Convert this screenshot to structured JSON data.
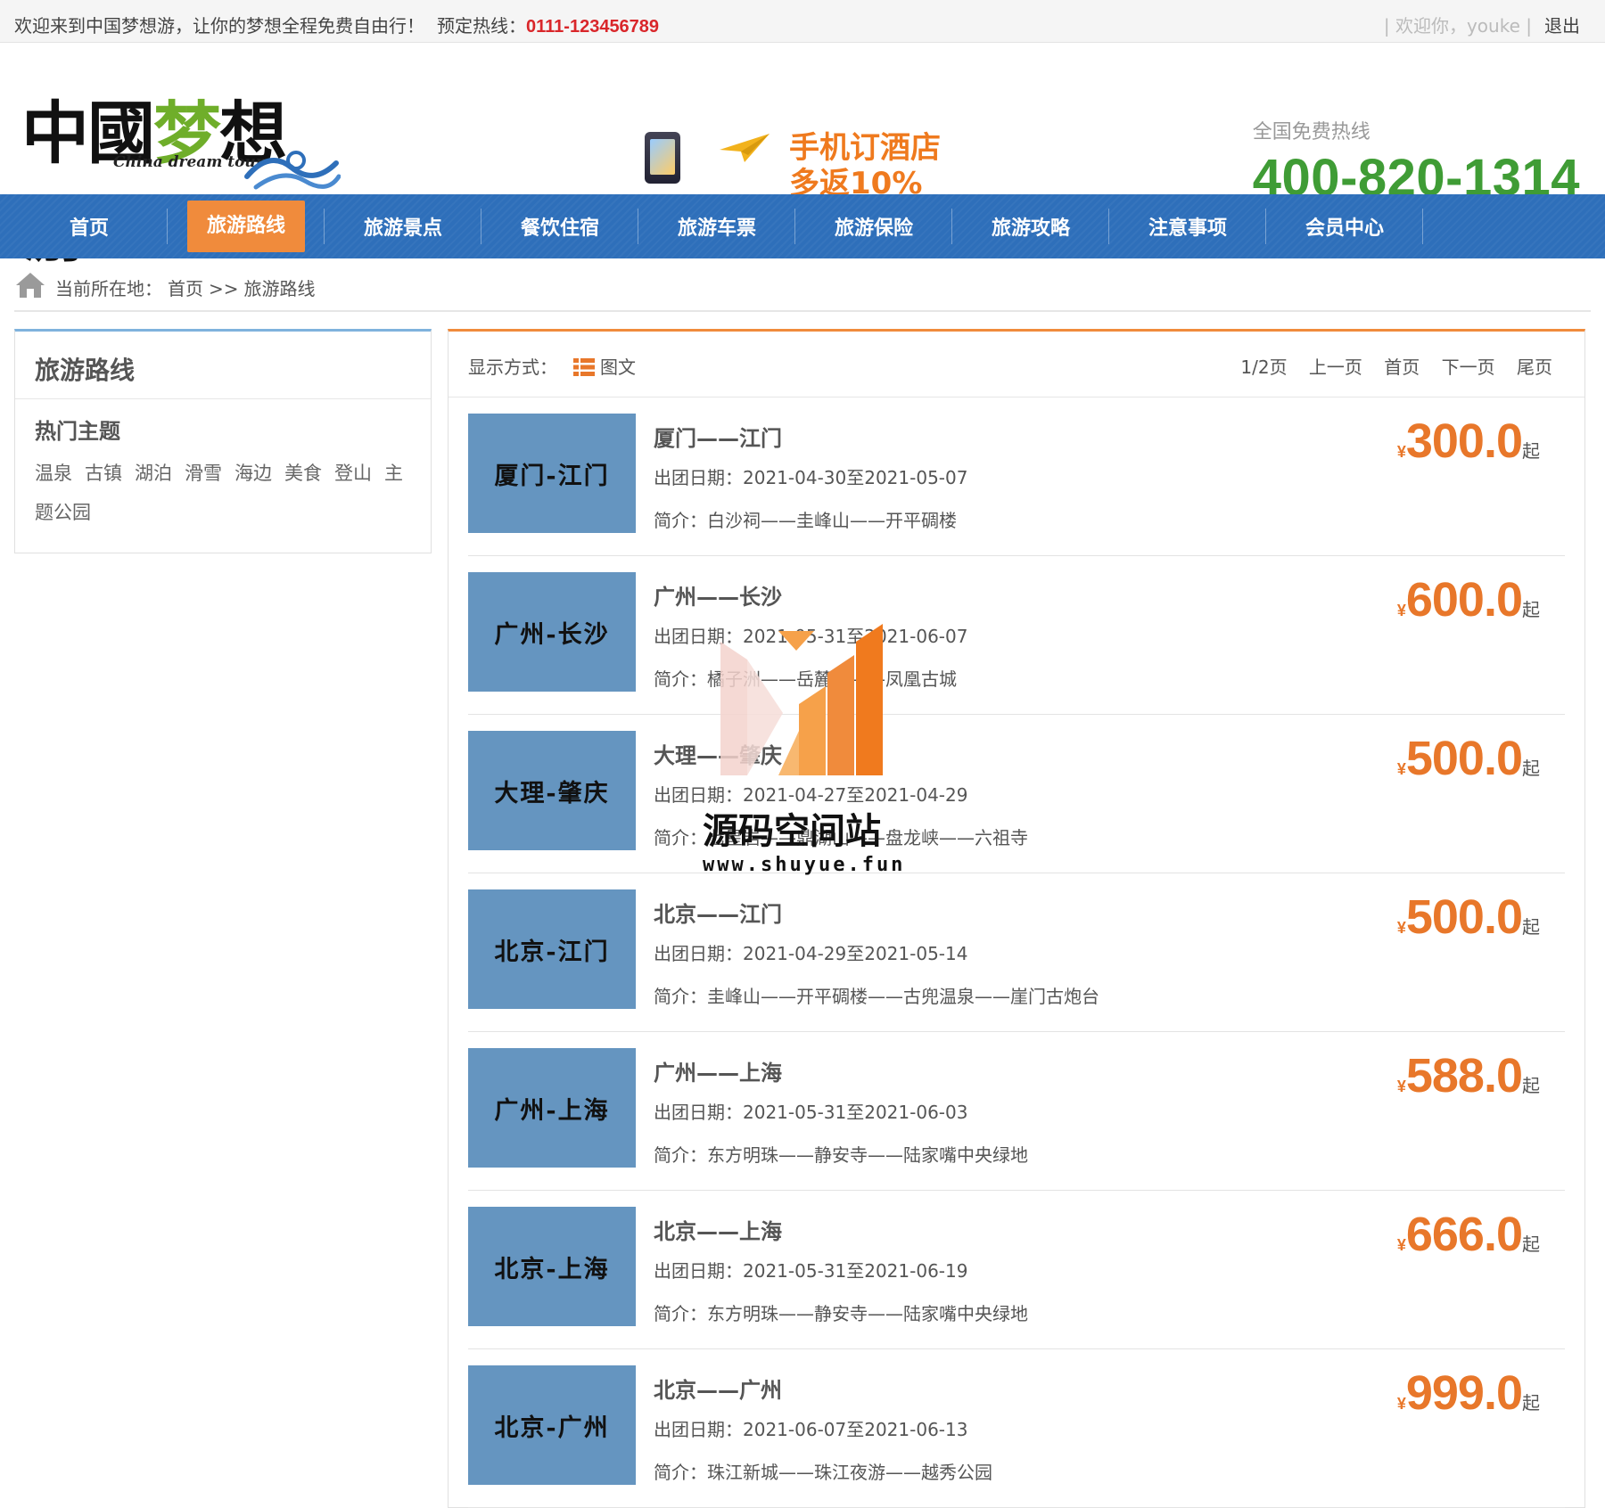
{
  "topbar": {
    "welcome": "欢迎来到中国梦想游，让你的梦想全程免费自由行！",
    "hotline_label": "预定热线：",
    "hotline": "0111-123456789",
    "greeting": "| 欢迎你，youke |",
    "logout": "退出"
  },
  "header": {
    "logo_cn_a": "中國",
    "logo_cn_b": "梦",
    "logo_cn_c": "想游",
    "logo_en": "China dream tour",
    "promo_line1": "手机订酒店",
    "promo_line2": "多返10%",
    "free_hotline_label": "全国免费热线",
    "free_hotline": "400-820-1314"
  },
  "nav": {
    "items": [
      "首页",
      "旅游路线",
      "旅游景点",
      "餐饮住宿",
      "旅游车票",
      "旅游保险",
      "旅游攻略",
      "注意事项",
      "会员中心"
    ],
    "active_index": 1
  },
  "breadcrumb": {
    "prefix": "当前所在地：",
    "home": "首页",
    "sep": ">>",
    "current": "旅游路线"
  },
  "sidebar": {
    "title": "旅游路线",
    "subtitle": "热门主题",
    "tags": [
      "温泉",
      "古镇",
      "湖泊",
      "滑雪",
      "海边",
      "美食",
      "登山",
      "主题公园"
    ]
  },
  "toolbar": {
    "mode_label": "显示方式：",
    "mode_value": "图文",
    "page_info": "1/2页",
    "prev": "上一页",
    "first": "首页",
    "next": "下一页",
    "last": "尾页"
  },
  "routes": [
    {
      "thumb": "厦门-江门",
      "name": "厦门——江门",
      "date_label": "出团日期：",
      "date": "2021-04-30至2021-05-07",
      "intro_label": "简介：",
      "intro": "白沙祠——圭峰山——开平碉楼",
      "currency": "¥",
      "price": "300.0",
      "suffix": "起"
    },
    {
      "thumb": "广州-长沙",
      "name": "广州——长沙",
      "date_label": "出团日期：",
      "date": "2021-05-31至2021-06-07",
      "intro_label": "简介：",
      "intro": "橘子洲——岳麓山——凤凰古城",
      "currency": "¥",
      "price": "600.0",
      "suffix": "起"
    },
    {
      "thumb": "大理-肇庆",
      "name": "大理——肇庆",
      "date_label": "出团日期：",
      "date": "2021-04-27至2021-04-29",
      "intro_label": "简介：",
      "intro": "七星岩——鼎湖山——盘龙峡——六祖寺",
      "currency": "¥",
      "price": "500.0",
      "suffix": "起"
    },
    {
      "thumb": "北京-江门",
      "name": "北京——江门",
      "date_label": "出团日期：",
      "date": "2021-04-29至2021-05-14",
      "intro_label": "简介：",
      "intro": "圭峰山——开平碉楼——古兜温泉——崖门古炮台",
      "currency": "¥",
      "price": "500.0",
      "suffix": "起"
    },
    {
      "thumb": "广州-上海",
      "name": "广州——上海",
      "date_label": "出团日期：",
      "date": "2021-05-31至2021-06-03",
      "intro_label": "简介：",
      "intro": "东方明珠——静安寺——陆家嘴中央绿地",
      "currency": "¥",
      "price": "588.0",
      "suffix": "起"
    },
    {
      "thumb": "北京-上海",
      "name": "北京——上海",
      "date_label": "出团日期：",
      "date": "2021-05-31至2021-06-19",
      "intro_label": "简介：",
      "intro": "东方明珠——静安寺——陆家嘴中央绿地",
      "currency": "¥",
      "price": "666.0",
      "suffix": "起"
    },
    {
      "thumb": "北京-广州",
      "name": "北京——广州",
      "date_label": "出团日期：",
      "date": "2021-06-07至2021-06-13",
      "intro_label": "简介：",
      "intro": "珠江新城——珠江夜游——越秀公园",
      "currency": "¥",
      "price": "999.0",
      "suffix": "起"
    }
  ],
  "watermark": {
    "text": "源码空间站",
    "url": "www.shuyue.fun"
  },
  "colors": {
    "nav_bg": "#2e6fba",
    "nav_active": "#f08b3c",
    "price": "#e8772a",
    "hotline_red": "#d9262a",
    "hotline_green": "#3f9c35",
    "thumb_bg": "#6595c0"
  }
}
